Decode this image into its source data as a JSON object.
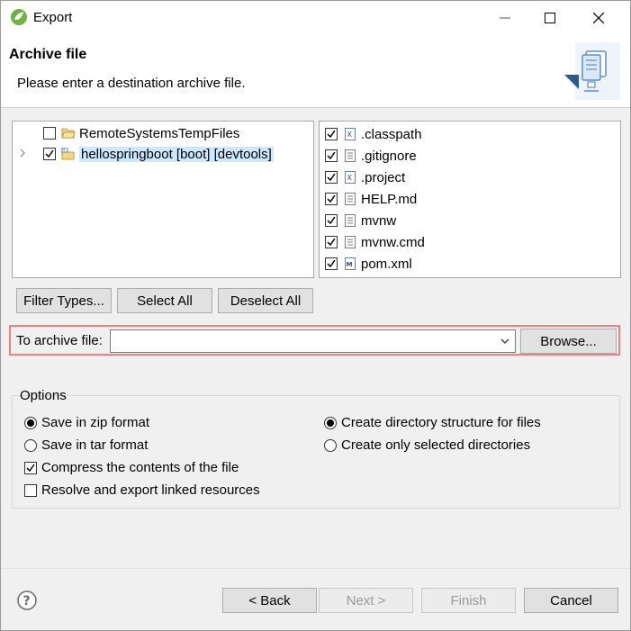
{
  "window": {
    "title": "Export"
  },
  "header": {
    "title": "Archive file",
    "description": "Please enter a destination archive file."
  },
  "tree": {
    "items": [
      {
        "label": "RemoteSystemsTempFiles",
        "checked": false,
        "expandable": false,
        "selected": false
      },
      {
        "label": "hellospringboot [boot] [devtools]",
        "checked": true,
        "expandable": true,
        "selected": true
      }
    ]
  },
  "files": {
    "items": [
      {
        "label": ".classpath",
        "icon": "xml-file-icon",
        "checked": true
      },
      {
        "label": ".gitignore",
        "icon": "text-file-icon",
        "checked": true
      },
      {
        "label": ".project",
        "icon": "xml-file-icon",
        "checked": true
      },
      {
        "label": "HELP.md",
        "icon": "text-file-icon",
        "checked": true
      },
      {
        "label": "mvnw",
        "icon": "text-file-icon",
        "checked": true
      },
      {
        "label": "mvnw.cmd",
        "icon": "text-file-icon",
        "checked": true
      },
      {
        "label": "pom.xml",
        "icon": "maven-pom-icon",
        "checked": true
      }
    ]
  },
  "selection_buttons": {
    "filter_types": "Filter Types...",
    "select_all": "Select All",
    "deselect_all": "Deselect All"
  },
  "archive": {
    "label": "To archive file:",
    "value": "",
    "browse": "Browse..."
  },
  "options": {
    "title": "Options",
    "save_zip": {
      "label": "Save in zip format",
      "selected": true
    },
    "save_tar": {
      "label": "Save in tar format",
      "selected": false
    },
    "compress": {
      "label": "Compress the contents of the file",
      "checked": true
    },
    "resolve_links": {
      "label": "Resolve and export linked resources",
      "checked": false
    },
    "create_dir_structure": {
      "label": "Create directory structure for files",
      "selected": true
    },
    "create_selected_dirs": {
      "label": "Create only selected directories",
      "selected": false
    }
  },
  "footer": {
    "back": "< Back",
    "next": "Next >",
    "finish": "Finish",
    "cancel": "Cancel"
  },
  "colors": {
    "selection": "#cce8ff",
    "highlight_border": "#f08080",
    "accent": "#6db33f"
  }
}
